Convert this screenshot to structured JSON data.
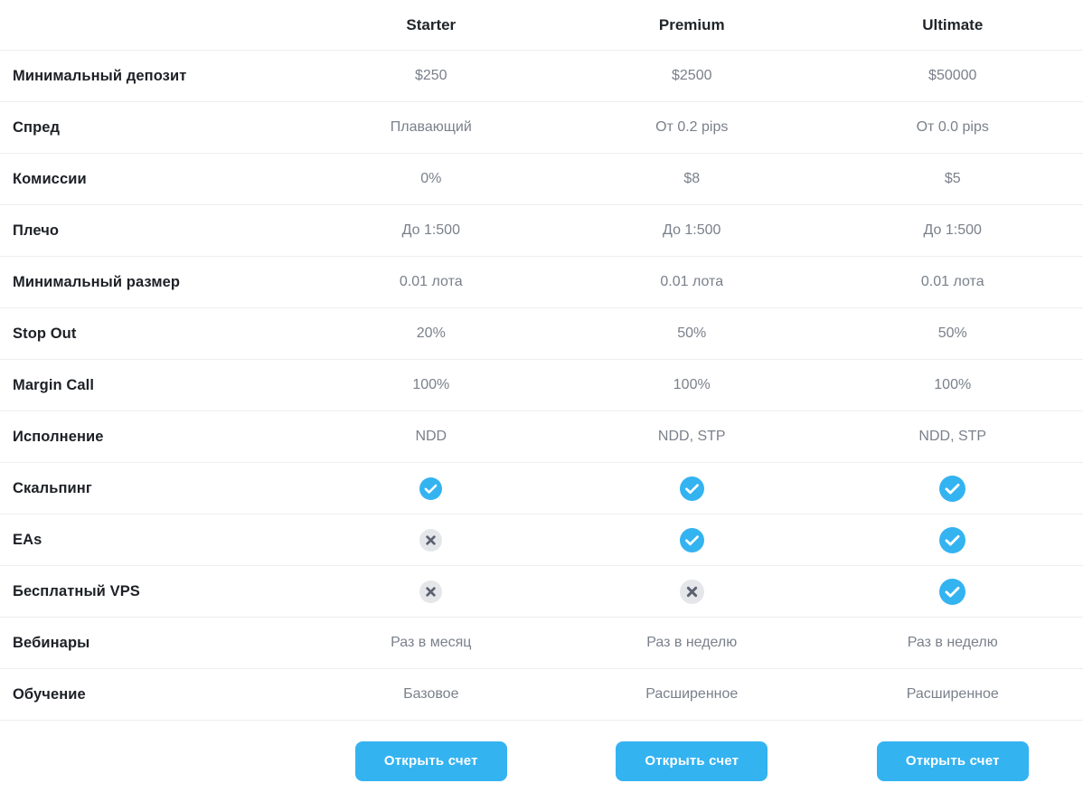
{
  "table": {
    "header": {
      "feature_label": "",
      "plans": [
        "Starter",
        "Premium",
        "Ultimate"
      ]
    },
    "rows": [
      {
        "feature": "Минимальный депозит",
        "values": [
          "$250",
          "$2500",
          "$50000"
        ],
        "kind": "text"
      },
      {
        "feature": "Спред",
        "values": [
          "Плавающий",
          "От 0.2 pips",
          "От 0.0 pips"
        ],
        "kind": "text"
      },
      {
        "feature": "Комиссии",
        "values": [
          "0%",
          "$8",
          "$5"
        ],
        "kind": "text"
      },
      {
        "feature": "Плечо",
        "values": [
          "До 1:500",
          "До 1:500",
          "До 1:500"
        ],
        "kind": "text"
      },
      {
        "feature": "Минимальный размер",
        "values": [
          "0.01 лота",
          "0.01 лота",
          "0.01 лота"
        ],
        "kind": "text"
      },
      {
        "feature": "Stop Out",
        "values": [
          "20%",
          "50%",
          "50%"
        ],
        "kind": "text"
      },
      {
        "feature": "Margin Call",
        "values": [
          "100%",
          "100%",
          "100%"
        ],
        "kind": "text"
      },
      {
        "feature": "Исполнение",
        "values": [
          "NDD",
          "NDD, STP",
          "NDD, STP"
        ],
        "kind": "text"
      },
      {
        "feature": "Скальпинг",
        "values": [
          "check-circle-icon",
          "check-circle-icon",
          "check-circle-icon"
        ],
        "kind": "icon"
      },
      {
        "feature": "EAs",
        "values": [
          "cross-circle-icon",
          "check-circle-icon",
          "check-circle-icon"
        ],
        "kind": "icon"
      },
      {
        "feature": "Бесплатный VPS",
        "values": [
          "cross-circle-icon",
          "cross-circle-icon",
          "check-circle-icon"
        ],
        "kind": "icon"
      },
      {
        "feature": "Вебинары",
        "values": [
          "Раз в месяц",
          "Раз в неделю",
          "Раз в неделю"
        ],
        "kind": "text"
      },
      {
        "feature": "Обучение",
        "values": [
          "Базовое",
          "Расширенное",
          "Расширенное"
        ],
        "kind": "text"
      }
    ],
    "cta": {
      "labels": [
        "Открыть счет",
        "Открыть счет",
        "Открыть счет"
      ]
    }
  },
  "colors": {
    "accent": "#34b3f1",
    "check_circle": "#34b3f1",
    "check_mark": "#ffffff",
    "cross_circle": "#e4e6ea",
    "cross_mark": "#5b616e",
    "divider": "#eceef0",
    "feature_text": "#1d2025",
    "value_text": "#7a808b",
    "header_text": "#212529",
    "button_text": "#ffffff",
    "background": "#ffffff"
  }
}
